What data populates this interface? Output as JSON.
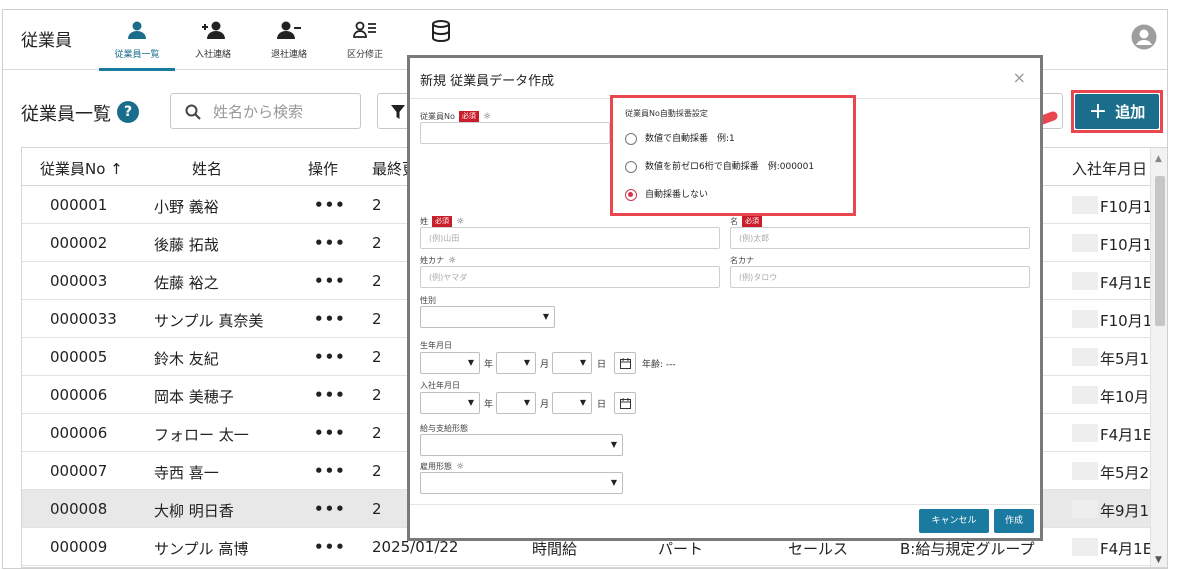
{
  "header": {
    "app_title": "従業員",
    "tabs": [
      {
        "label": "従業員一覧",
        "icon": "person-icon"
      },
      {
        "label": "入社連絡",
        "icon": "person-add-icon"
      },
      {
        "label": "退社連絡",
        "icon": "person-remove-icon"
      },
      {
        "label": "区分修正",
        "icon": "person-list-icon"
      },
      {
        "label": "",
        "icon": "database-icon"
      }
    ],
    "avatar_icon": "account-circle-icon"
  },
  "toolbar": {
    "list_title": "従業員一覧",
    "help_label": "?",
    "search_placeholder": "姓名から検索",
    "add_label": "追加",
    "add_plus": "+"
  },
  "table": {
    "columns": [
      "従業員No ↑",
      "姓名",
      "操作",
      "最終更",
      "入社年月日"
    ],
    "rows": [
      {
        "no": "000001",
        "name": "小野 義裕",
        "ops": "•••",
        "updated": "2",
        "joined": "F10月1"
      },
      {
        "no": "000002",
        "name": "後藤 拓哉",
        "ops": "•••",
        "updated": "2",
        "joined": "F10月1"
      },
      {
        "no": "000003",
        "name": "佐藤 裕之",
        "ops": "•••",
        "updated": "2",
        "joined": "F4月1E"
      },
      {
        "no": "0000033",
        "name": "サンプル 真奈美",
        "ops": "•••",
        "updated": "2",
        "joined": "F10月1"
      },
      {
        "no": "000005",
        "name": "鈴木 友紀",
        "ops": "•••",
        "updated": "2",
        "joined": "年5月1"
      },
      {
        "no": "000006",
        "name": "岡本 美穂子",
        "ops": "•••",
        "updated": "2",
        "joined": "年10月"
      },
      {
        "no": "000006",
        "name": "フォロー 太一",
        "ops": "•••",
        "updated": "2",
        "joined": "F4月1E"
      },
      {
        "no": "000007",
        "name": "寺西 喜一",
        "ops": "•••",
        "updated": "2",
        "joined": "年5月2"
      },
      {
        "no": "000008",
        "name": "大柳 明日香",
        "ops": "•••",
        "updated": "2",
        "joined": "年9月1",
        "selected": true
      },
      {
        "no": "000009",
        "name": "サンプル 高博",
        "ops": "•••",
        "updated": "2025/01/22",
        "pay": "時間給",
        "type": "パート",
        "dept": "セールス",
        "group": "B:給与規定グループ",
        "joined": "F4月1E"
      }
    ]
  },
  "modal": {
    "title": "新規 従業員データ作成",
    "close": "×",
    "employee_no_label": "従業員No",
    "required_badge": "必須",
    "auto_numbering": {
      "title": "従業員No自動採番設定",
      "options": [
        {
          "label": "数値で自動採番　例:1",
          "selected": false
        },
        {
          "label": "数値を前ゼロ6桁で自動採番　例:000001",
          "selected": false
        },
        {
          "label": "自動採番しない",
          "selected": true
        }
      ]
    },
    "last_name_label": "姓",
    "first_name_label": "名",
    "last_name_placeholder": "(例)山田",
    "first_name_placeholder": "(例)太郎",
    "last_kana_label": "姓カナ",
    "first_kana_label": "名カナ",
    "last_kana_placeholder": "(例)ヤマダ",
    "first_kana_placeholder": "(例)タロウ",
    "gender_label": "性別",
    "birth_label": "生年月日",
    "year_unit": "年",
    "month_unit": "月",
    "day_unit": "日",
    "age_label": "年齢: ---",
    "join_label": "入社年月日",
    "pay_type_label": "給与支給形態",
    "employment_label": "雇用形態",
    "cancel_label": "キャンセル",
    "create_label": "作成"
  },
  "colors": {
    "accent": "#1b6d8c",
    "highlight": "#e8474f",
    "required": "#c81d2a",
    "radio_selected": "#d0334b"
  }
}
